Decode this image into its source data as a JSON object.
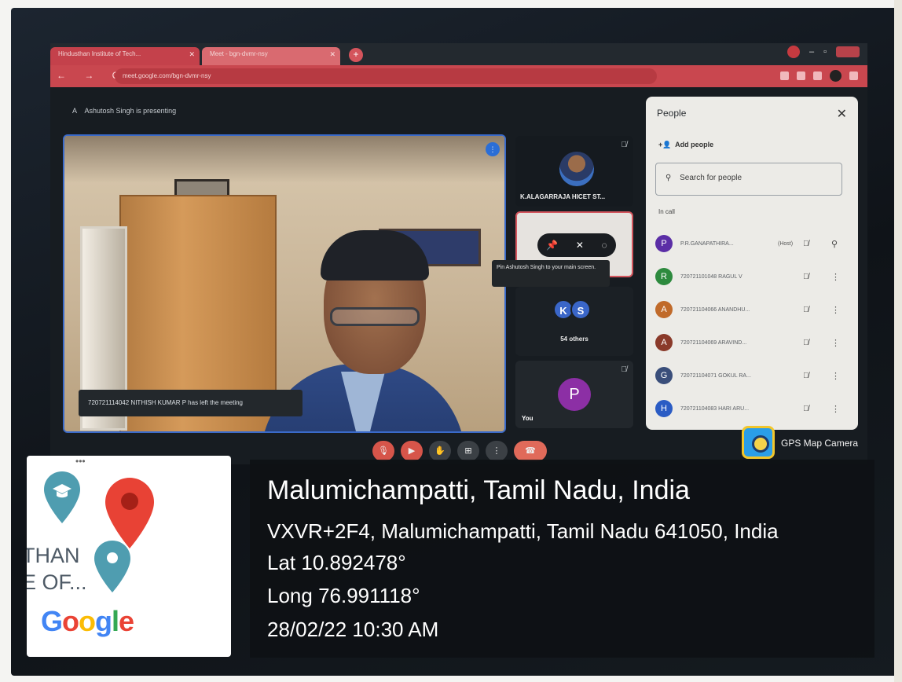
{
  "browser": {
    "tabs": [
      {
        "label": "Hindusthan Institute of Tech..."
      },
      {
        "label": "Meet - bgn-dvmr-nsy"
      }
    ],
    "new_tab": "+",
    "url": "meet.google.com/bgn-dvmr-nsy",
    "nav": "← → C"
  },
  "meet": {
    "presenting": "Ashutosh Singh is presenting",
    "presenting_icon": "A",
    "toast": "720721114042 NITHISH KUMAR P has left the meeting",
    "tile1_name": "K.ALAGARRAJA HICET ST...",
    "tooltip": "Pin Ashutosh Singh to your main screen.",
    "others_avatars": [
      "K",
      "S"
    ],
    "others_label": "54 others",
    "you_avatar": "P",
    "you_label": "You"
  },
  "people_panel": {
    "title": "People",
    "close": "✕",
    "add_people": "Add people",
    "search_placeholder": "Search for people",
    "in_call": "In call",
    "participants": [
      {
        "initial": "P",
        "name": "P.R.GANAPATHIRA...",
        "host": "(Host)",
        "color": "#5b2ea6"
      },
      {
        "initial": "R",
        "name": "720721101048 RAGUL V",
        "host": "",
        "color": "#2d8a3e"
      },
      {
        "initial": "A",
        "name": "720721104066 ANANDHU...",
        "host": "",
        "color": "#c06a2a"
      },
      {
        "initial": "A",
        "name": "720721104069 ARAVIND...",
        "host": "",
        "color": "#8a3a2a"
      },
      {
        "initial": "G",
        "name": "720721104071 GOKUL RA...",
        "host": "",
        "color": "#3a4e7a"
      },
      {
        "initial": "H",
        "name": "720721104083 HARI ARU...",
        "host": "",
        "color": "#2b5cc4"
      }
    ]
  },
  "gps_app": {
    "name": "GPS Map Camera"
  },
  "map_card": {
    "dots": "•••",
    "text_line1": "THAN",
    "text_line2": "E OF...",
    "google": [
      "G",
      "o",
      "o",
      "g",
      "l",
      "e"
    ]
  },
  "location": {
    "place": "Malumichampatti, Tamil Nadu, India",
    "address": "VXVR+2F4, Malumichampatti, Tamil Nadu 641050, India",
    "lat": "Lat 10.892478°",
    "long": "Long 76.991118°",
    "datetime": "28/02/22 10:30 AM"
  },
  "colors": {
    "google_blue": "#4285f4",
    "google_red": "#ea4335",
    "google_yellow": "#fbbc05",
    "google_green": "#34a853"
  }
}
